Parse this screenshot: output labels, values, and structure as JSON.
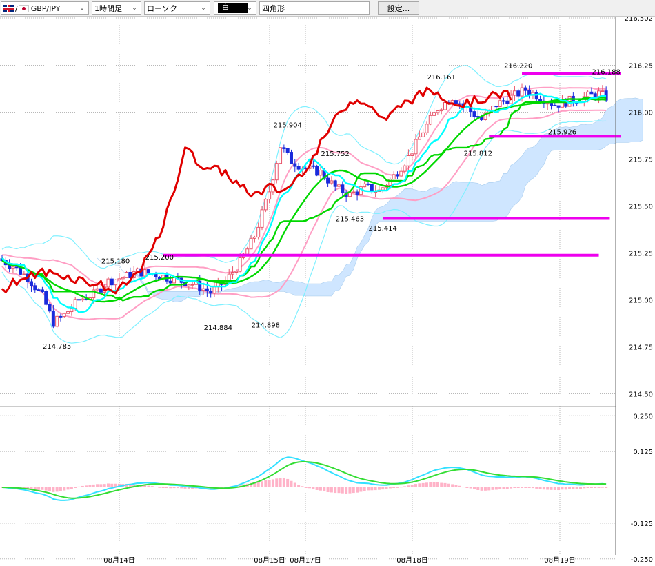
{
  "toolbar": {
    "symbol": "GBP/JPY",
    "timeframe": "1時間足",
    "chart_style": "ローソク",
    "color_label": "白",
    "drawing_tool": "四角形",
    "settings_button": "設定..."
  },
  "colors": {
    "up_candle": "#e8556b",
    "down_candle": "#1a2bdc",
    "conversion_line": "#00ffff",
    "base_line": "#00d800",
    "lagging_span": "#e00000",
    "bollinger_inner": "#ff9ec4",
    "bollinger_outer": "#7ff0ff",
    "cloud": "#cfe6ff",
    "lines": "#ee00ee",
    "macd": "#33e0ff",
    "signal": "#33dd33",
    "histogram": "#ffb3c8"
  },
  "chart_data": [
    {
      "type": "candlestick",
      "y_ticks": [
        "216.502",
        "216.25",
        "216.00",
        "215.75",
        "215.50",
        "215.25",
        "215.00",
        "214.75",
        "214.50"
      ],
      "ylim": [
        214.44,
        216.52
      ],
      "x_ticks": [
        "08月14日",
        "08月15日",
        "08月17日",
        "08月18日",
        "08月19日"
      ],
      "grid": true,
      "annotations": [
        {
          "text": "214.785",
          "candle": 15,
          "value": 214.785,
          "pos": "below"
        },
        {
          "text": "215.180",
          "candle": 31,
          "value": 215.18,
          "pos": "above"
        },
        {
          "text": "215.200",
          "candle": 43,
          "value": 215.2,
          "pos": "above"
        },
        {
          "text": "214.884",
          "candle": 59,
          "value": 214.884,
          "pos": "below"
        },
        {
          "text": "214.898",
          "candle": 72,
          "value": 214.898,
          "pos": "below"
        },
        {
          "text": "215.904",
          "candle": 78,
          "value": 215.904,
          "pos": "above"
        },
        {
          "text": "215.752",
          "candle": 91,
          "value": 215.752,
          "pos": "above"
        },
        {
          "text": "215.463",
          "candle": 95,
          "value": 215.463,
          "pos": "below"
        },
        {
          "text": "215.414",
          "candle": 104,
          "value": 215.414,
          "pos": "below"
        },
        {
          "text": "216.161",
          "candle": 120,
          "value": 216.161,
          "pos": "above"
        },
        {
          "text": "215.812",
          "candle": 130,
          "value": 215.812,
          "pos": "below"
        },
        {
          "text": "216.220",
          "candle": 141,
          "value": 216.22,
          "pos": "above"
        },
        {
          "text": "215.926",
          "candle": 153,
          "value": 215.926,
          "pos": "below"
        },
        {
          "text": "216.188",
          "candle": 165,
          "value": 216.188,
          "pos": "above"
        }
      ],
      "horizontal_lines": [
        {
          "value": 215.238,
          "from_candle": 44,
          "to_candle": 163
        },
        {
          "value": 215.434,
          "from_candle": 104,
          "to_candle": 166
        },
        {
          "value": 215.872,
          "from_candle": 133,
          "to_candle": 169
        },
        {
          "value": 216.208,
          "from_candle": 142,
          "to_candle": 169
        }
      ]
    },
    {
      "type": "bar",
      "y_ticks": [
        "0.250",
        "0.125",
        "-0.125",
        "-0.250"
      ],
      "ylim": [
        -0.25,
        0.25
      ],
      "x_ticks": [
        "08月14日",
        "08月15日",
        "08月17日",
        "08月18日",
        "08月19日"
      ],
      "grid": true
    }
  ]
}
